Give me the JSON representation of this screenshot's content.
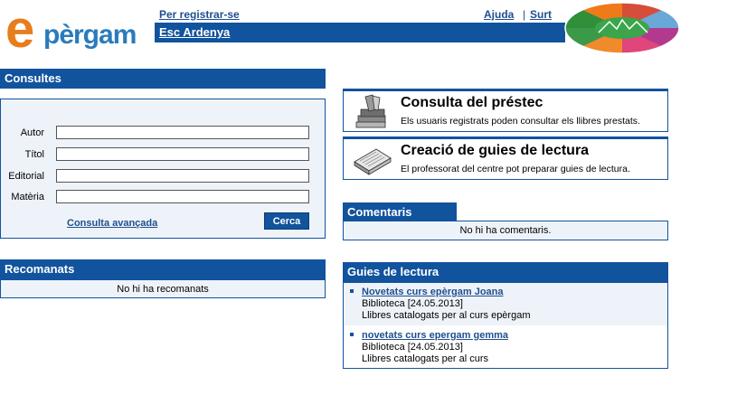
{
  "header": {
    "logo_e": "e",
    "logo_rest": "pèrgam",
    "register_link": "Per registrar-se",
    "help_link": "Ajuda",
    "separator": "|",
    "exit_link": "Surt",
    "school_name": "Esc Ardenya"
  },
  "consultes": {
    "title": "Consultes",
    "fields": [
      {
        "label": "Autor",
        "value": ""
      },
      {
        "label": "Títol",
        "value": ""
      },
      {
        "label": "Editorial",
        "value": ""
      },
      {
        "label": "Matèria",
        "value": ""
      }
    ],
    "advanced_link": "Consulta avançada",
    "search_button": "Cerca"
  },
  "recomanats": {
    "title": "Recomanats",
    "empty_text": "No hi ha recomanats"
  },
  "cards": [
    {
      "title": "Consulta del préstec",
      "desc": "Els usuaris registrats poden consultar els llibres prestats."
    },
    {
      "title": "Creació de guies de lectura",
      "desc": "El professorat del centre pot preparar guies de lectura."
    }
  ],
  "comentaris": {
    "title": "Comentaris",
    "empty_text": "No hi ha comentaris."
  },
  "guies": {
    "title": "Guies de lectura",
    "items": [
      {
        "title": "Novetats curs epèrgam Joana",
        "meta": "Biblioteca [24.05.2013]",
        "desc": "Llibres catalogats per al curs epèrgam"
      },
      {
        "title": "novetats curs epergam gemma",
        "meta": "Biblioteca [24.05.2013]",
        "desc": "Llibres catalogats per al curs"
      }
    ]
  },
  "colors": {
    "primary": "#12539e",
    "panel_bg": "#eef3f9",
    "logo_orange": "#e87d1e",
    "logo_blue": "#2a7bbd"
  }
}
